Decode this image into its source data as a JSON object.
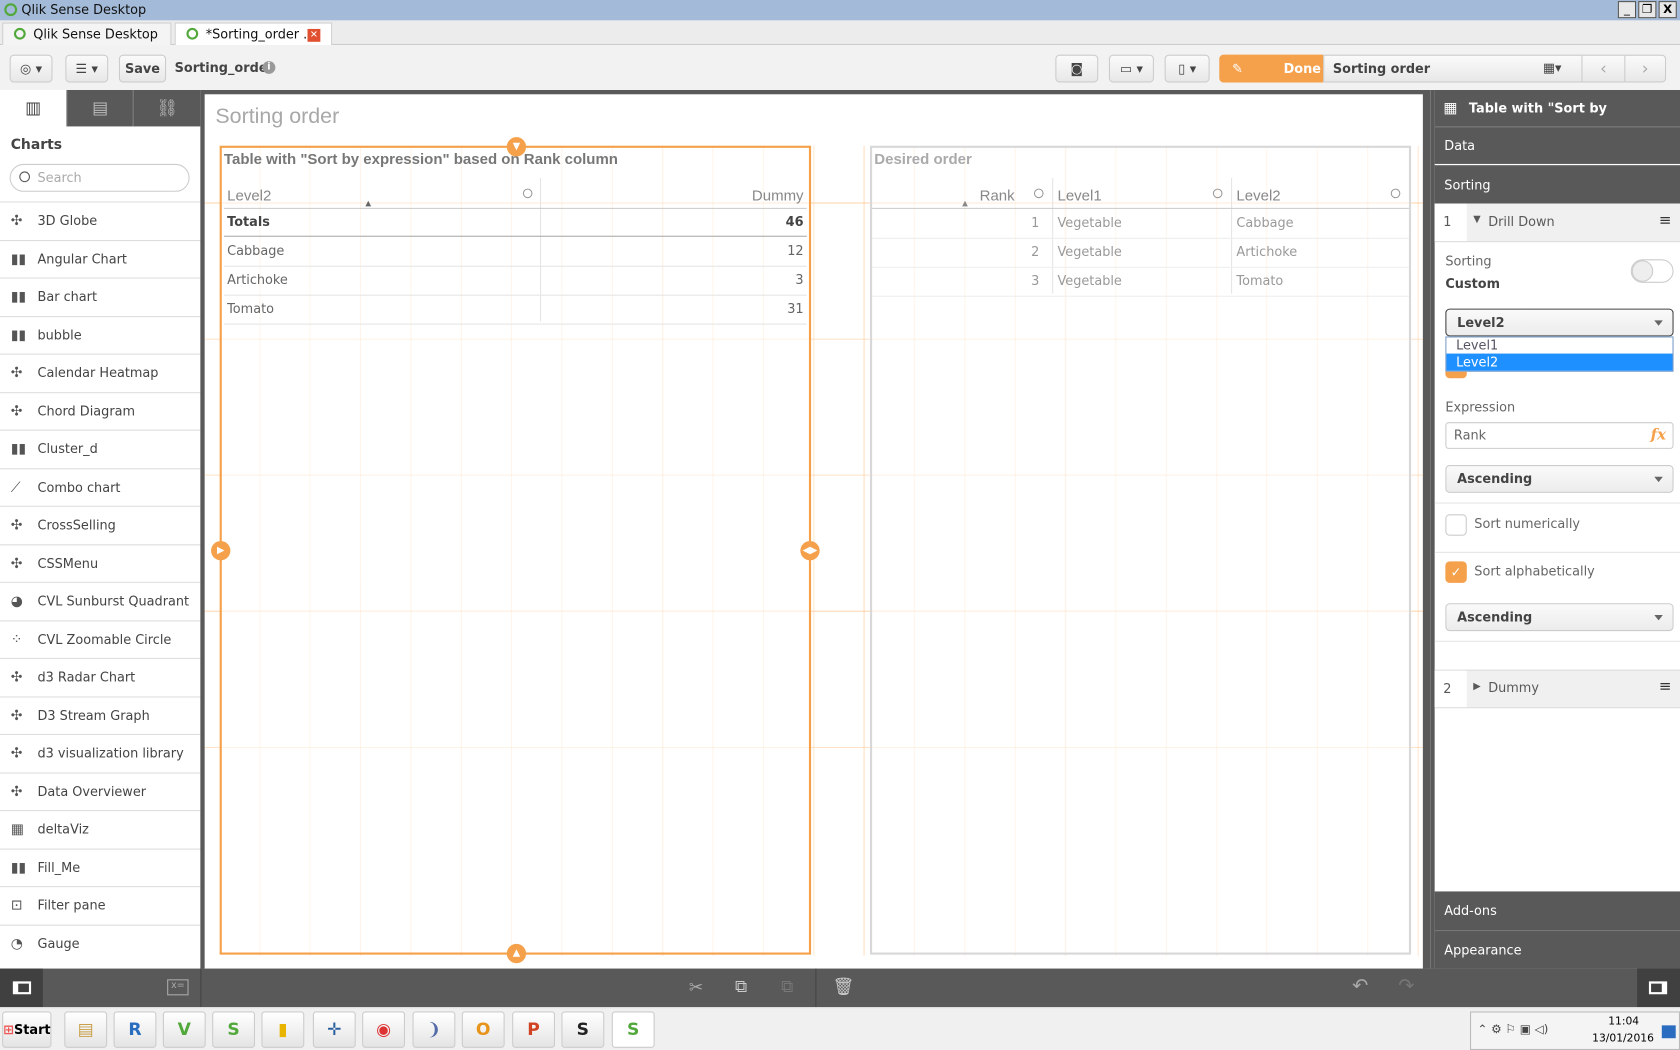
{
  "window": {
    "title": "Qlik Sense Desktop",
    "minimize": "_",
    "restore": "❐",
    "close": "X"
  },
  "tabs": [
    {
      "label": "Qlik Sense Desktop hub"
    },
    {
      "label": "*Sorting_order ..."
    }
  ],
  "toolbar": {
    "save_label": "Save",
    "app_name": "Sorting_order",
    "done_label": "Done",
    "sheet_name": "Sorting order"
  },
  "left_panel": {
    "heading": "Charts",
    "search_placeholder": "Search",
    "items": [
      "3D Globe",
      "Angular Chart",
      "Bar chart",
      "bubble",
      "Calendar Heatmap",
      "Chord Diagram",
      "Cluster_d",
      "Combo chart",
      "CrossSelling",
      "CSSMenu",
      "CVL Sunburst Quadrant",
      "CVL Zoomable Circle Pa...",
      "d3 Radar Chart",
      "D3 Stream Graph",
      "d3 visualization library",
      "Data Overviewer",
      "deltaViz",
      "Fill_Me",
      "Filter pane",
      "Gauge"
    ]
  },
  "sheet": {
    "title": "Sorting order"
  },
  "table1": {
    "title": "Table with \"Sort by expression\" based on Rank column",
    "columns": [
      "Level2",
      "Dummy"
    ],
    "totals_label": "Totals",
    "totals_value": "46",
    "rows": [
      [
        "Cabbage",
        "12"
      ],
      [
        "Artichoke",
        "3"
      ],
      [
        "Tomato",
        "31"
      ]
    ]
  },
  "table2": {
    "title": "Desired order",
    "columns": [
      "Rank",
      "Level1",
      "Level2"
    ],
    "rows": [
      [
        "1",
        "Vegetable",
        "Cabbage"
      ],
      [
        "2",
        "Vegetable",
        "Artichoke"
      ],
      [
        "3",
        "Vegetable",
        "Tomato"
      ]
    ]
  },
  "properties": {
    "title": "Table with \"Sort by expression\" ...",
    "data_label": "Data",
    "sorting_label": "Sorting",
    "dim1": {
      "index": "1",
      "name": "Drill Down"
    },
    "sorting_text": "Sorting",
    "sorting_mode": "Custom",
    "field_select": "Level2",
    "field_options": [
      "Level1",
      "Level2"
    ],
    "expression_label": "Expression",
    "expression_value": "Rank",
    "fx": "fx",
    "order1": "Ascending",
    "sort_numerically": "Sort numerically",
    "sort_alphabetically": "Sort alphabetically",
    "order2": "Ascending",
    "dim2": {
      "index": "2",
      "name": "Dummy"
    },
    "addons_label": "Add-ons",
    "appearance_label": "Appearance"
  },
  "taskbar": {
    "start": "Start",
    "time": "11:04",
    "date": "13/01/2016"
  },
  "colors": {
    "accent": "#f5a04a",
    "dark": "#595959",
    "selected": "#1e90ff"
  }
}
